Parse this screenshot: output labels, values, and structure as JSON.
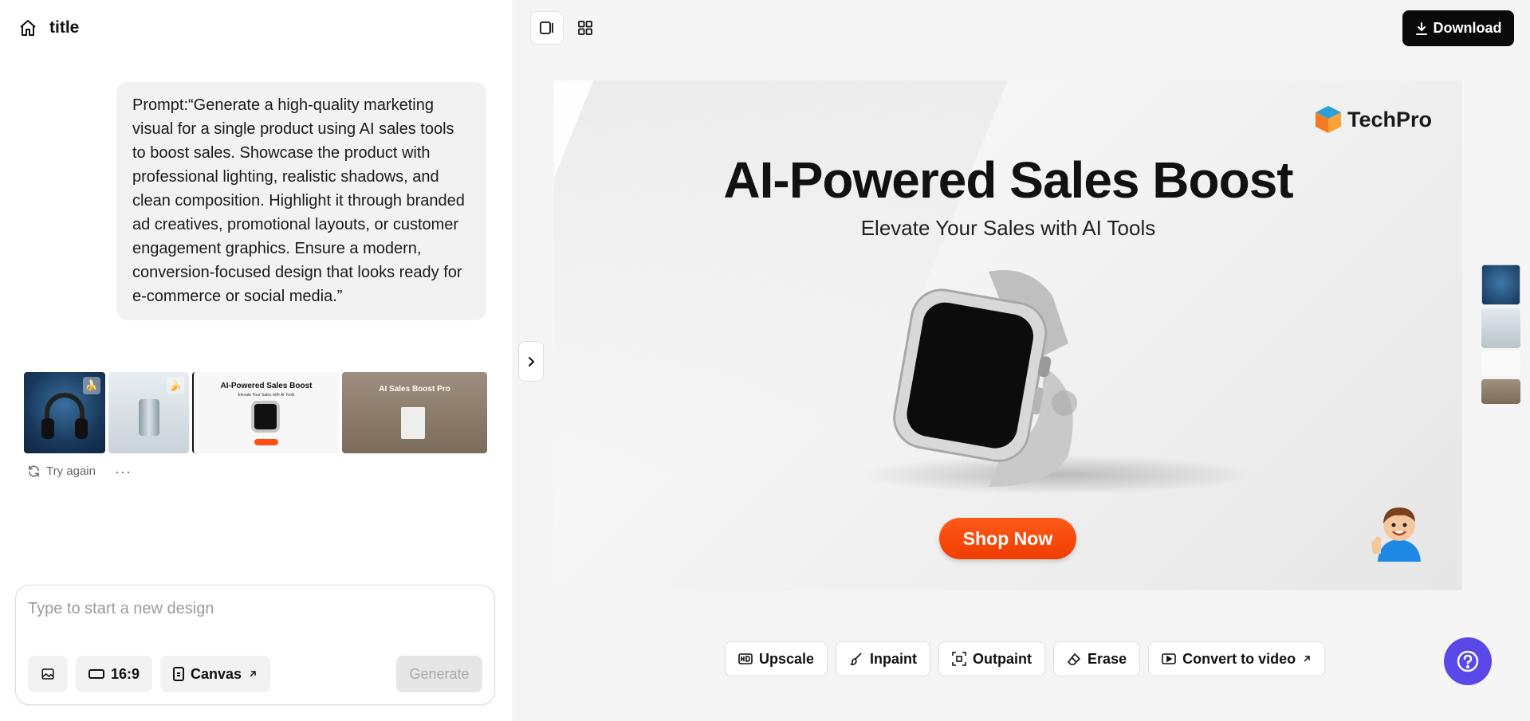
{
  "header": {
    "title": "title"
  },
  "prompt": {
    "text": "Prompt:“Generate a high-quality marketing visual for a single product using AI sales tools to boost sales. Showcase the product with professional lighting, realistic shadows, and clean composition. Highlight it through branded ad creatives, promotional layouts, or customer engagement graphics. Ensure a modern, conversion-focused design that looks ready for e-commerce or social media.”"
  },
  "thumbnails": {
    "t3_title": "AI-Powered Sales Boost",
    "t3_sub": "Elevate Your Sales with AI Tools",
    "t4_title": "AI Sales Boost Pro"
  },
  "actions": {
    "try_again": "Try again",
    "more": "···"
  },
  "composer": {
    "placeholder": "Type to start a new design",
    "ratio": "16:9",
    "canvas": "Canvas",
    "generate": "Generate"
  },
  "toolbar": {
    "download": "Download"
  },
  "canvas": {
    "logo": "TechPro",
    "headline": "AI-Powered Sales Boost",
    "subhead": "Elevate Your Sales with AI Tools",
    "cta": "Shop Now"
  },
  "edit_tools": {
    "upscale": "Upscale",
    "inpaint": "Inpaint",
    "outpaint": "Outpaint",
    "erase": "Erase",
    "convert": "Convert to video"
  },
  "colors": {
    "accent": "#5b48e8",
    "cta": "#ff4e0f",
    "download_bg": "#0a0a0a"
  }
}
